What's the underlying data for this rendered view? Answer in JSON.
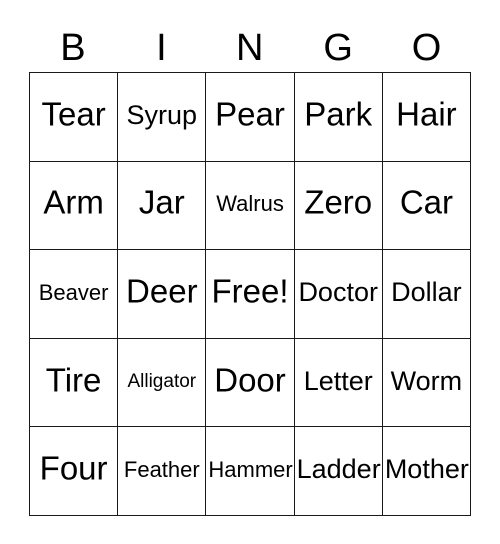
{
  "card": {
    "title": "BINGO",
    "free_space_label": "Free!",
    "columns": [
      "B",
      "I",
      "N",
      "G",
      "O"
    ],
    "colors": {
      "background": "#ffffff",
      "border": "#1a1a1a",
      "text": "#000000"
    },
    "rows": [
      [
        {
          "label": "Tear",
          "size": "len-s"
        },
        {
          "label": "Syrup",
          "size": "len-m"
        },
        {
          "label": "Pear",
          "size": "len-s"
        },
        {
          "label": "Park",
          "size": "len-s"
        },
        {
          "label": "Hair",
          "size": "len-s"
        }
      ],
      [
        {
          "label": "Arm",
          "size": "len-s"
        },
        {
          "label": "Jar",
          "size": "len-s"
        },
        {
          "label": "Walrus",
          "size": "len-l"
        },
        {
          "label": "Zero",
          "size": "len-s"
        },
        {
          "label": "Car",
          "size": "len-s"
        }
      ],
      [
        {
          "label": "Beaver",
          "size": "len-l"
        },
        {
          "label": "Deer",
          "size": "len-s"
        },
        {
          "label": "Free!",
          "size": "len-s"
        },
        {
          "label": "Doctor",
          "size": "len-m"
        },
        {
          "label": "Dollar",
          "size": "len-m"
        }
      ],
      [
        {
          "label": "Tire",
          "size": "len-s"
        },
        {
          "label": "Alligator",
          "size": "len-xl"
        },
        {
          "label": "Door",
          "size": "len-s"
        },
        {
          "label": "Letter",
          "size": "len-m"
        },
        {
          "label": "Worm",
          "size": "len-m"
        }
      ],
      [
        {
          "label": "Four",
          "size": "len-s"
        },
        {
          "label": "Feather",
          "size": "len-l"
        },
        {
          "label": "Hammer",
          "size": "len-l"
        },
        {
          "label": "Ladder",
          "size": "len-m"
        },
        {
          "label": "Mother",
          "size": "len-m"
        }
      ]
    ]
  }
}
